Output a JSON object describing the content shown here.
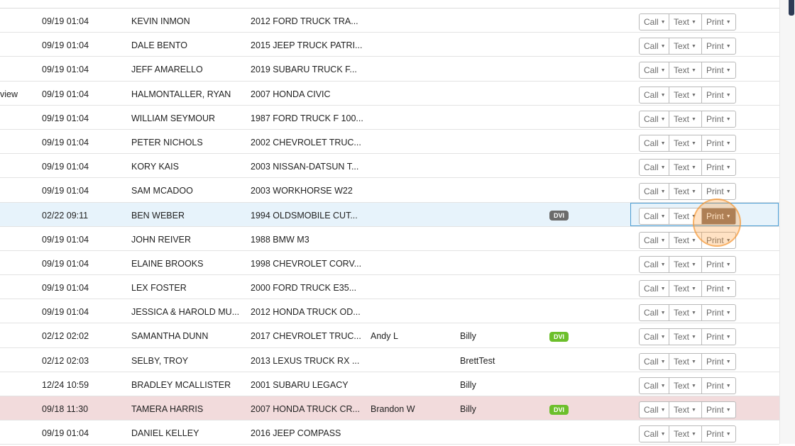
{
  "colors": {
    "dvi_gray": "#6b6b6b",
    "dvi_green": "#6cbf2b",
    "selected_row": "#e7f3fb",
    "highlight_row": "#f2dbdc",
    "active_print": "#8c7260"
  },
  "actions": {
    "call_label": "Call",
    "text_label": "Text",
    "print_label": "Print",
    "caret_icon": "caret-down-icon"
  },
  "rows": [
    {
      "status": "",
      "date": "09/19 01:04",
      "customer": "KEVIN INMON",
      "vehicle": "2012 FORD TRUCK TRA...",
      "advisor": "",
      "tech": "",
      "badge": "",
      "badge_color": ""
    },
    {
      "status": "",
      "date": "09/19 01:04",
      "customer": "DALE BENTO",
      "vehicle": "2015 JEEP TRUCK PATRI...",
      "advisor": "",
      "tech": "",
      "badge": "",
      "badge_color": ""
    },
    {
      "status": "",
      "date": "09/19 01:04",
      "customer": "JEFF AMARELLO",
      "vehicle": "2019 SUBARU TRUCK F...",
      "advisor": "",
      "tech": "",
      "badge": "",
      "badge_color": ""
    },
    {
      "status": "view",
      "date": "09/19 01:04",
      "customer": "HALMONTALLER, RYAN",
      "vehicle": "2007 HONDA CIVIC",
      "advisor": "",
      "tech": "",
      "badge": "",
      "badge_color": ""
    },
    {
      "status": "",
      "date": "09/19 01:04",
      "customer": "WILLIAM SEYMOUR",
      "vehicle": "1987 FORD TRUCK F 100...",
      "advisor": "",
      "tech": "",
      "badge": "",
      "badge_color": ""
    },
    {
      "status": "",
      "date": "09/19 01:04",
      "customer": "PETER NICHOLS",
      "vehicle": "2002 CHEVROLET TRUC...",
      "advisor": "",
      "tech": "",
      "badge": "",
      "badge_color": ""
    },
    {
      "status": "",
      "date": "09/19 01:04",
      "customer": "KORY KAIS",
      "vehicle": "2003 NISSAN-DATSUN T...",
      "advisor": "",
      "tech": "",
      "badge": "",
      "badge_color": ""
    },
    {
      "status": "",
      "date": "09/19 01:04",
      "customer": "SAM MCADOO",
      "vehicle": "2003 WORKHORSE W22",
      "advisor": "",
      "tech": "",
      "badge": "",
      "badge_color": ""
    },
    {
      "status": "",
      "date": "02/22 09:11",
      "customer": "BEN WEBER",
      "vehicle": "1994 OLDSMOBILE CUT...",
      "advisor": "",
      "tech": "",
      "badge": "DVI",
      "badge_color": "#6b6b6b",
      "selected": true
    },
    {
      "status": "",
      "date": "09/19 01:04",
      "customer": "JOHN REIVER",
      "vehicle": "1988 BMW M3",
      "advisor": "",
      "tech": "",
      "badge": "",
      "badge_color": ""
    },
    {
      "status": "",
      "date": "09/19 01:04",
      "customer": "ELAINE BROOKS",
      "vehicle": "1998 CHEVROLET CORV...",
      "advisor": "",
      "tech": "",
      "badge": "",
      "badge_color": ""
    },
    {
      "status": "",
      "date": "09/19 01:04",
      "customer": "LEX FOSTER",
      "vehicle": "2000 FORD TRUCK E35...",
      "advisor": "",
      "tech": "",
      "badge": "",
      "badge_color": ""
    },
    {
      "status": "",
      "date": "09/19 01:04",
      "customer": "JESSICA & HAROLD MU...",
      "vehicle": "2012 HONDA TRUCK OD...",
      "advisor": "",
      "tech": "",
      "badge": "",
      "badge_color": ""
    },
    {
      "status": "",
      "date": "02/12 02:02",
      "customer": "SAMANTHA DUNN",
      "vehicle": "2017 CHEVROLET TRUC...",
      "advisor": "Andy L",
      "tech": "Billy",
      "badge": "DVI",
      "badge_color": "#6cbf2b"
    },
    {
      "status": "",
      "date": "02/12 02:03",
      "customer": "SELBY, TROY",
      "vehicle": "2013 LEXUS TRUCK RX ...",
      "advisor": "",
      "tech": "BrettTest",
      "badge": "",
      "badge_color": ""
    },
    {
      "status": "",
      "date": "12/24 10:59",
      "customer": "BRADLEY MCALLISTER",
      "vehicle": "2001 SUBARU LEGACY",
      "advisor": "",
      "tech": "Billy",
      "badge": "",
      "badge_color": ""
    },
    {
      "status": "",
      "date": "09/18 11:30",
      "customer": "TAMERA HARRIS",
      "vehicle": "2007 HONDA TRUCK CR...",
      "advisor": "Brandon W",
      "tech": "Billy",
      "badge": "DVI",
      "badge_color": "#6cbf2b",
      "highlight": true
    },
    {
      "status": "",
      "date": "09/19 01:04",
      "customer": "DANIEL KELLEY",
      "vehicle": "2016 JEEP COMPASS",
      "advisor": "",
      "tech": "",
      "badge": "",
      "badge_color": ""
    }
  ]
}
